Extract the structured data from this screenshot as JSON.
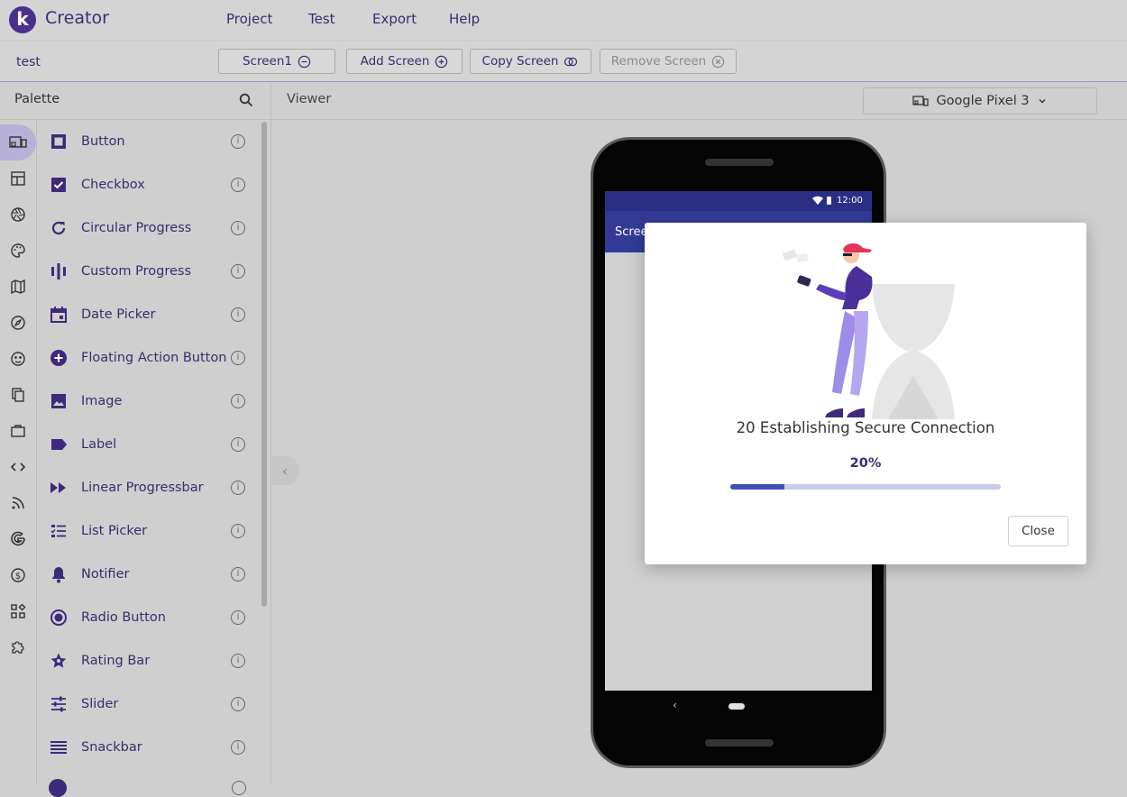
{
  "header": {
    "logo_letter": "k",
    "brand": "Creator",
    "menu": [
      "Project",
      "Test",
      "Export",
      "Help"
    ]
  },
  "screenbar": {
    "project_name": "test",
    "screen_select": "Screen1",
    "add_screen": "Add Screen",
    "copy_screen": "Copy Screen",
    "remove_screen": "Remove Screen"
  },
  "palette": {
    "title": "Palette",
    "items": [
      {
        "label": "Button",
        "icon": "button-icon"
      },
      {
        "label": "Checkbox",
        "icon": "checkbox-icon"
      },
      {
        "label": "Circular Progress",
        "icon": "circular-progress-icon"
      },
      {
        "label": "Custom Progress",
        "icon": "custom-progress-icon"
      },
      {
        "label": "Date Picker",
        "icon": "date-picker-icon"
      },
      {
        "label": "Floating Action Button",
        "icon": "fab-icon"
      },
      {
        "label": "Image",
        "icon": "image-icon"
      },
      {
        "label": "Label",
        "icon": "label-icon"
      },
      {
        "label": "Linear Progressbar",
        "icon": "linear-progress-icon"
      },
      {
        "label": "List Picker",
        "icon": "list-picker-icon"
      },
      {
        "label": "Notifier",
        "icon": "notifier-icon"
      },
      {
        "label": "Radio Button",
        "icon": "radio-button-icon"
      },
      {
        "label": "Rating Bar",
        "icon": "rating-bar-icon"
      },
      {
        "label": "Slider",
        "icon": "slider-icon"
      },
      {
        "label": "Snackbar",
        "icon": "snackbar-icon"
      }
    ]
  },
  "viewer": {
    "title": "Viewer",
    "device": "Google Pixel 3"
  },
  "phone": {
    "clock": "12:00",
    "app_title": "Scree"
  },
  "dialog": {
    "message": "20 Establishing Secure Connection",
    "percent_label": "20%",
    "progress": 0.2,
    "close": "Close"
  },
  "colors": {
    "accent": "#3d2a7a",
    "progress": "#3f51b5",
    "app_bar": "#323a96"
  }
}
